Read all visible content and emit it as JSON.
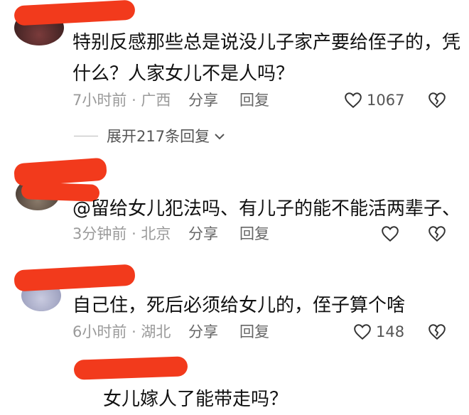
{
  "comments": [
    {
      "text_lines": [
        "特别反感那些总是说没儿子家产要给侄子的，凭",
        "什么？人家女儿不是人吗？"
      ],
      "time": "7小时前",
      "location": "广西",
      "share_label": "分享",
      "reply_label": "回复",
      "like_count": "1067",
      "expand_label": "展开217条回复"
    },
    {
      "text_lines": [
        "@留给女儿犯法吗、有儿子的能不能活两辈子、"
      ],
      "time": "3分钟前",
      "location": "北京",
      "share_label": "分享",
      "reply_label": "回复",
      "like_count": ""
    },
    {
      "text_lines": [
        "自己住，死后必须给女儿的，侄子算个啥"
      ],
      "time": "6小时前",
      "location": "湖北",
      "share_label": "分享",
      "reply_label": "回复",
      "like_count": "148"
    },
    {
      "text_lines": [
        "女儿嫁人了能带走吗？"
      ]
    }
  ],
  "colors": {
    "redaction": "#f23a1c",
    "meta_text": "#9a9a9a",
    "body_text": "#111111"
  },
  "icons": [
    "heart-icon",
    "broken-heart-icon",
    "chevron-down-icon"
  ]
}
